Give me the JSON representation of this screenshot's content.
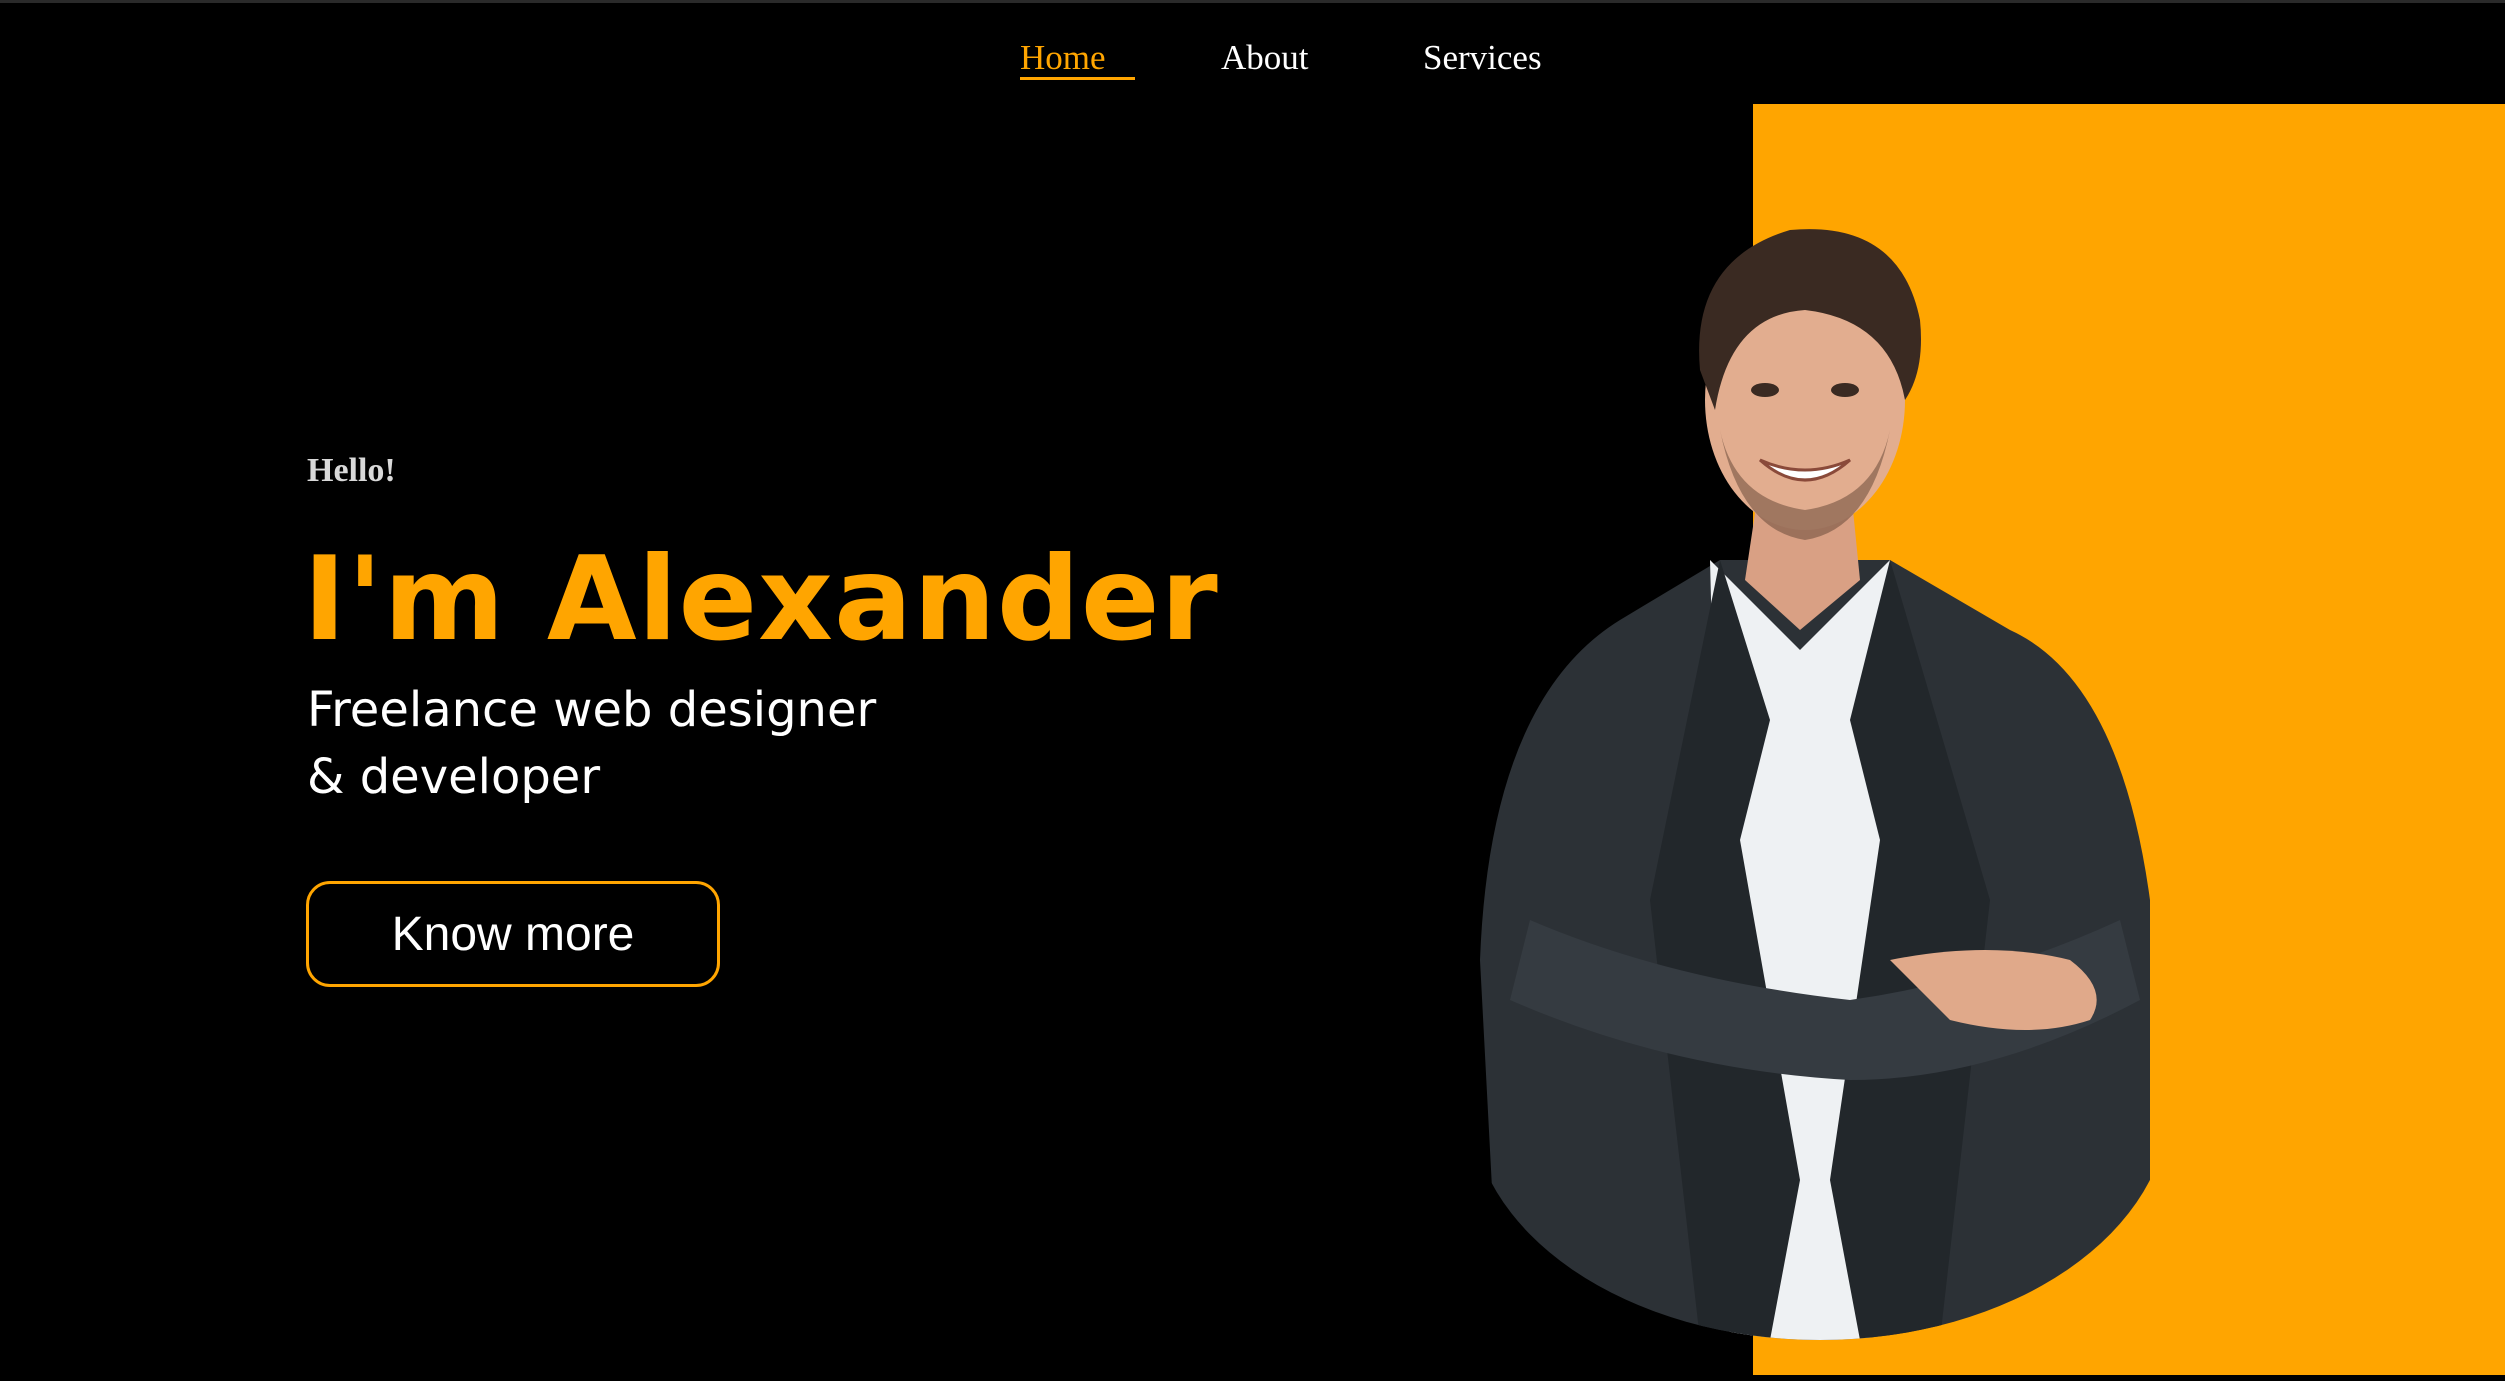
{
  "nav": {
    "items": [
      {
        "label": "Home",
        "active": true
      },
      {
        "label": "About",
        "active": false
      },
      {
        "label": "Services",
        "active": false
      }
    ]
  },
  "hero": {
    "greeting": "Hello!",
    "name": "I'm Alexander",
    "role_line1": "Freelance web designer",
    "role_line2": "& developer",
    "cta_label": "Know more"
  },
  "colors": {
    "background": "#000000",
    "accent": "#ffa500",
    "text": "#ffffff"
  },
  "portrait": {
    "icon": "person-portrait-icon"
  }
}
